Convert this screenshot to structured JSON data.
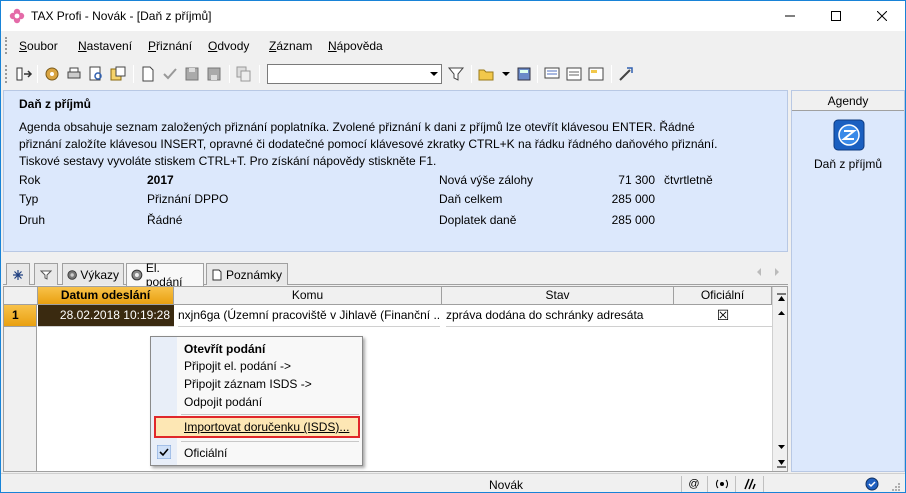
{
  "window": {
    "title": "TAX Profi - Novák - [Daň z příjmů]",
    "minimize": "—",
    "maximize": "☐",
    "close": "✕"
  },
  "menu": {
    "items": [
      {
        "label": "Soubor",
        "key": "S",
        "rest": "oubor"
      },
      {
        "label": "Nastavení",
        "key": "N",
        "rest": "astavení"
      },
      {
        "label": "Přiznání",
        "key": "P",
        "rest": "řiznání"
      },
      {
        "label": "Odvody",
        "key": "O",
        "rest": "dvody"
      },
      {
        "label": "Záznam",
        "key": "Z",
        "rest": "áznam"
      },
      {
        "label": "Nápověda",
        "key": "N",
        "rest": "ápověda"
      }
    ]
  },
  "info": {
    "title": "Daň z příjmů",
    "description": "Agenda obsahuje seznam založených přiznání poplatníka. Zvolené přiznání k dani z příjmů lze otevřít klávesou ENTER. Řádné přiznání založíte klávesou INSERT, opravné či dodatečné pomocí klávesové zkratky CTRL+K na řádku řádného daňového přiznání. Tiskové sestavy vyvoláte stiskem CTRL+T. Pro získání nápovědy stiskněte F1.",
    "rok_label": "Rok",
    "rok_value": "2017",
    "typ_label": "Typ",
    "typ_value": "Přiznání DPPO",
    "druh_label": "Druh",
    "druh_value": "Řádné",
    "zaloha_label": "Nová výše zálohy",
    "zaloha_value": "71 300",
    "zaloha_period": "čtvrtletně",
    "dan_label": "Daň celkem",
    "dan_value": "285 000",
    "doplatek_label": "Doplatek daně",
    "doplatek_value": "285 000"
  },
  "tabs": {
    "vykazy": "Výkazy",
    "el_podani": "El. podání",
    "poznamky": "Poznámky"
  },
  "grid": {
    "columns": [
      "Datum odeslání",
      "Komu",
      "Stav",
      "Oficiální"
    ],
    "rows": [
      {
        "num": "1",
        "datum": "28.02.2018  10:19:28",
        "komu": "nxjn6ga (Územní pracoviště v Jihlavě (Finanční ...",
        "stav": "zpráva dodána do schránky adresáta",
        "oficialni": "☒"
      }
    ]
  },
  "context_menu": {
    "otevrit": "Otevřít podání",
    "pripojit_el": "Připojit el. podání ->",
    "pripojit_isds": "Připojit záznam ISDS ->",
    "odpojit": "Odpojit podání",
    "importovat": "Importovat doručenku (ISDS)...",
    "oficialni": "Oficiální"
  },
  "agendy": {
    "header": "Agendy",
    "item": "Daň z příjmů"
  },
  "status": {
    "user": "Novák"
  },
  "colors": {
    "accent": "#1883d7",
    "panel": "#dce8fc",
    "sorted_header": "#f8c24a",
    "highlight_border": "#e0272a"
  }
}
